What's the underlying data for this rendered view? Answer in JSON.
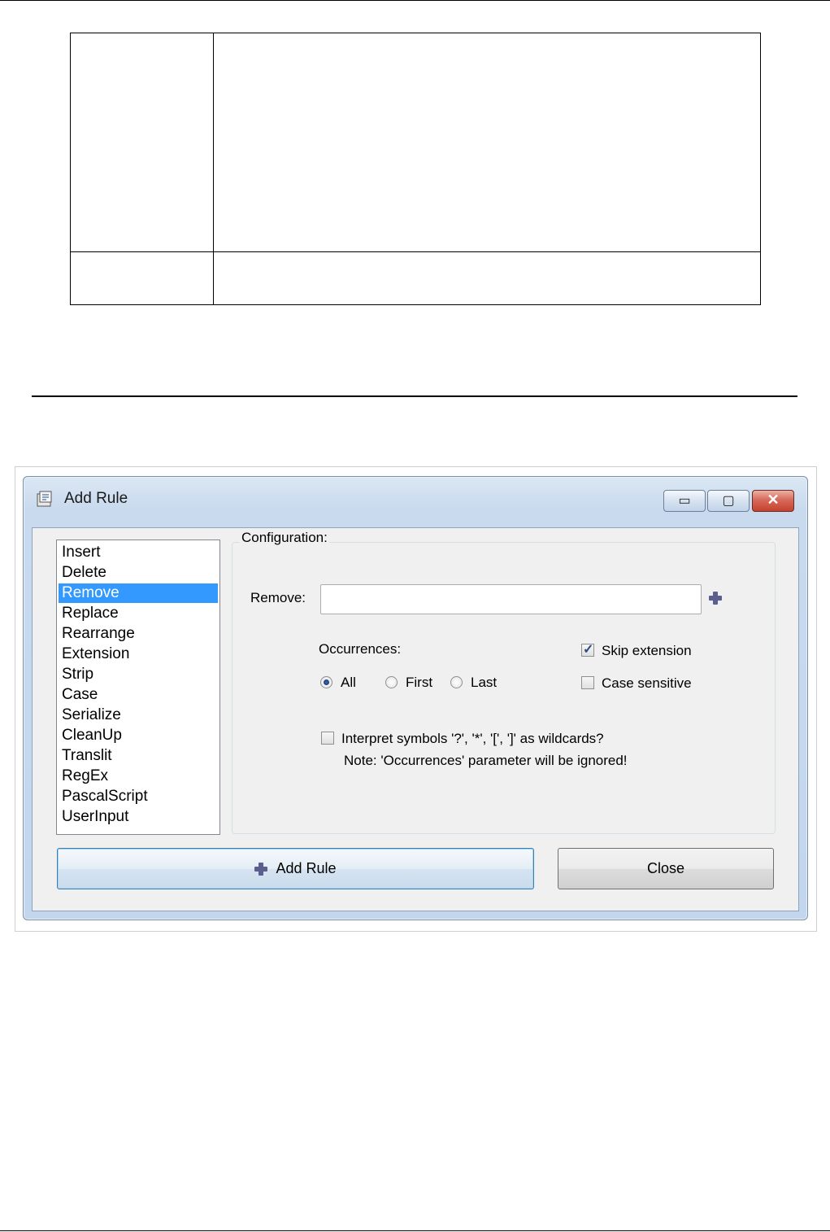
{
  "window": {
    "title": "Add Rule",
    "controls": {
      "minimize": "▭",
      "maximize": "▢",
      "close": "✕"
    }
  },
  "rule_list": {
    "items": [
      "Insert",
      "Delete",
      "Remove",
      "Replace",
      "Rearrange",
      "Extension",
      "Strip",
      "Case",
      "Serialize",
      "CleanUp",
      "Translit",
      "RegEx",
      "PascalScript",
      "UserInput"
    ],
    "selected_index": 2
  },
  "config": {
    "group_label": "Configuration:",
    "remove_label": "Remove:",
    "remove_value": "",
    "occurrences_label": "Occurrences:",
    "options": [
      {
        "label": "All",
        "checked": true
      },
      {
        "label": "First",
        "checked": false
      },
      {
        "label": "Last",
        "checked": false
      }
    ],
    "skip_extension": {
      "label": "Skip extension",
      "checked": true
    },
    "case_sensitive": {
      "label": "Case sensitive",
      "checked": false
    },
    "wildcards": {
      "label": "Interpret symbols '?', '*', '[', ']' as wildcards?",
      "checked": false
    },
    "note": "Note: 'Occurrences' parameter will be ignored!"
  },
  "buttons": {
    "add_rule": "Add Rule",
    "close": "Close"
  },
  "colors": {
    "selection": "#3399ff",
    "window_frame": "#c2d6ee",
    "close_button": "#c5432f"
  }
}
